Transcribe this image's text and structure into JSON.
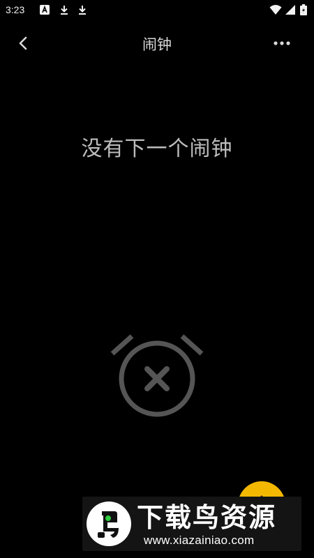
{
  "status_bar": {
    "time": "3:23",
    "icons": [
      "font-notification-icon",
      "download-icon",
      "download-icon",
      "wifi-icon",
      "cellular-icon",
      "battery-charging-icon"
    ]
  },
  "toolbar": {
    "title": "闹钟",
    "back_icon": "chevron-left-icon",
    "more_icon": "more-horizontal-icon"
  },
  "main": {
    "empty_message": "没有下一个闹钟",
    "illustration_icon": "alarm-off-icon"
  },
  "fab": {
    "icon": "add-icon"
  },
  "watermark": {
    "name": "下载鸟资源",
    "url": "www.xiazainiao.com"
  },
  "colors": {
    "background": "#000000",
    "icon_gray": "#555555",
    "fab_accent": "#f5b800"
  }
}
